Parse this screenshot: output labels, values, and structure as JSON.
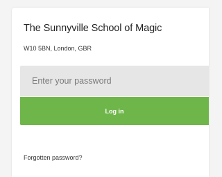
{
  "school": {
    "name": "The Sunnyville School of Magic",
    "address": "W10 5BN, London, GBR"
  },
  "login": {
    "password_placeholder": "Enter your password",
    "password_value": "",
    "submit_label": "Log in",
    "forgot_label": "Forgotten password?"
  },
  "colors": {
    "accent": "#6fb64a",
    "input_bg": "#e6e6e6"
  }
}
